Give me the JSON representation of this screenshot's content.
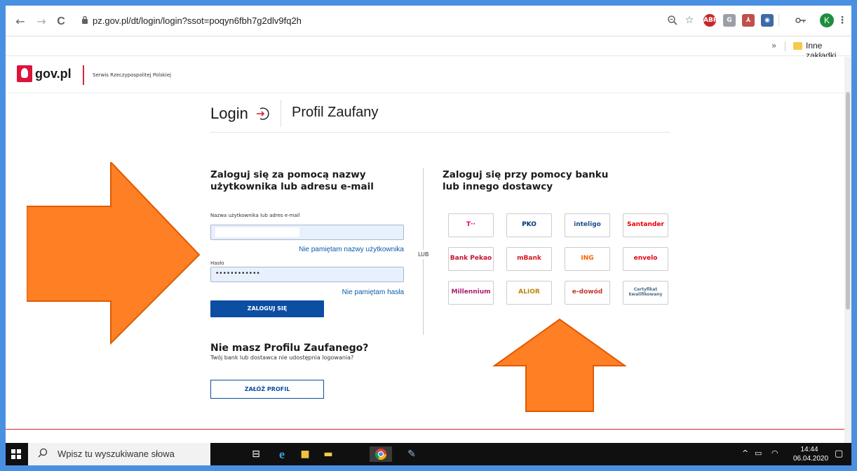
{
  "browser": {
    "url_host": "pz.gov.pl",
    "url_path": "/dt/login/login?ssot=poqyn6fbh7g2dlv9fq2h",
    "back_icon": "←",
    "forward_icon": "→",
    "reload_icon": "C",
    "avatar_letter": "K",
    "bookmarks": {
      "more": "»",
      "folder_label": "Inne zakładki"
    },
    "extensions": [
      "ABP",
      "G"
    ]
  },
  "header": {
    "logo_text": "gov.pl",
    "subtitle": "Serwis Rzeczypospolitej Polskiej"
  },
  "page": {
    "login_title": "Login",
    "service_title": "Profil Zaufany"
  },
  "login_form": {
    "heading": "Zaloguj się za pomocą nazwy użytkownika lub adresu e-mail",
    "username_label": "Nazwa użytkownika lub adres e-mail",
    "username_value": "",
    "forgot_username": "Nie pamiętam nazwy użytkownika",
    "password_label": "Hasło",
    "password_value": "••••••••••••",
    "forgot_password": "Nie pamiętam hasła",
    "submit_label": "ZALOGUJ SIĘ"
  },
  "no_profile": {
    "heading": "Nie masz Profilu Zaufanego?",
    "subtitle": "Twój bank lub dostawca nie udostępnia logowania?",
    "create_label": "ZAŁÓŻ PROFIL"
  },
  "separator": "LUB",
  "bank_login": {
    "heading": "Zaloguj się przy pomocy banku lub innego dostawcy",
    "providers": [
      {
        "label": "T··",
        "color": "#e20074"
      },
      {
        "label": "PKO",
        "color": "#003574"
      },
      {
        "label": "inteligo",
        "color": "#1e4b8f"
      },
      {
        "label": "Santander",
        "color": "#ec0000"
      },
      {
        "label": "Bank Pekao",
        "color": "#c8102e"
      },
      {
        "label": "mBank",
        "color": "#d4181f"
      },
      {
        "label": "ING",
        "color": "#ff6200"
      },
      {
        "label": "envelo",
        "color": "#e30613"
      },
      {
        "label": "Millennium",
        "color": "#a51f6f"
      },
      {
        "label": "ALIOR",
        "color": "#b8860b"
      },
      {
        "label": "e-dowód",
        "color": "#c0392b"
      },
      {
        "label": "Certyfikat kwalifikowany",
        "color": "#4a6b8a"
      }
    ]
  },
  "taskbar": {
    "search_placeholder": "Wpisz tu wyszukiwane słowa",
    "time": "14:44",
    "date": "06.04.2020"
  },
  "colors": {
    "frame_blue": "#4a90e2",
    "gov_blue": "#0b4ea2",
    "gov_red": "#d5233b",
    "arrow_orange": "#ff7f24"
  }
}
